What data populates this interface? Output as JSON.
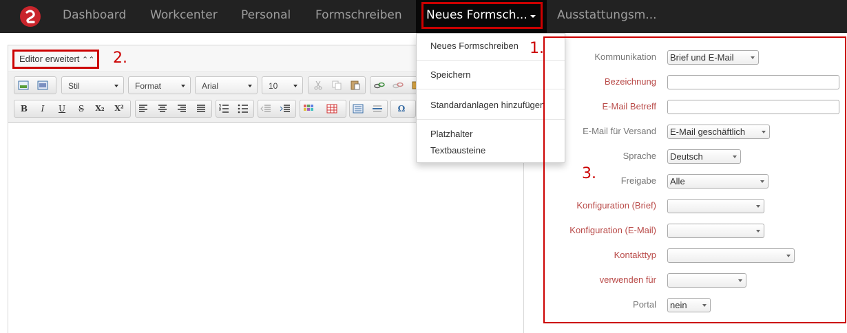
{
  "nav": {
    "items": [
      "Dashboard",
      "Workcenter",
      "Personal",
      "Formschreiben"
    ],
    "active": "Neues Formsch...",
    "after": "Ausstattungsm..."
  },
  "annotations": {
    "one": "1.",
    "two": "2.",
    "three": "3."
  },
  "editor": {
    "toggle_label": "Editor erweitert",
    "toggle_icon": "double-chevron-up-icon",
    "toolbar": {
      "style": "Stil",
      "format": "Format",
      "font": "Arial",
      "size": "10",
      "bold": "B",
      "italic": "I",
      "underline": "U",
      "strike": "S",
      "subscript": "X₂",
      "superscript": "X²",
      "special_char": "Ω"
    }
  },
  "menu": {
    "items": [
      "Neues Formschreiben",
      "Speichern",
      "Standardanlagen hinzufügen",
      "Platzhalter",
      "Textbausteine"
    ]
  },
  "form": {
    "kommunikation": {
      "label": "Kommunikation",
      "value": "Brief und E-Mail"
    },
    "bezeichnung": {
      "label": "Bezeichnung",
      "value": ""
    },
    "email_betreff": {
      "label": "E-Mail Betreff",
      "value": ""
    },
    "email_versand": {
      "label": "E-Mail für Versand",
      "value": "E-Mail geschäftlich"
    },
    "sprache": {
      "label": "Sprache",
      "value": "Deutsch"
    },
    "freigabe": {
      "label": "Freigabe",
      "value": "Alle"
    },
    "konfig_brief": {
      "label": "Konfiguration (Brief)",
      "value": ""
    },
    "konfig_email": {
      "label": "Konfiguration (E-Mail)",
      "value": ""
    },
    "kontakttyp": {
      "label": "Kontakttyp",
      "value": ""
    },
    "verwenden_fuer": {
      "label": "verwenden für",
      "value": ""
    },
    "portal": {
      "label": "Portal",
      "value": "nein"
    }
  },
  "colors": {
    "navbar": "#222222",
    "annotation_red": "#cc0000",
    "required_label": "#b94a48",
    "normal_label": "#777777"
  }
}
